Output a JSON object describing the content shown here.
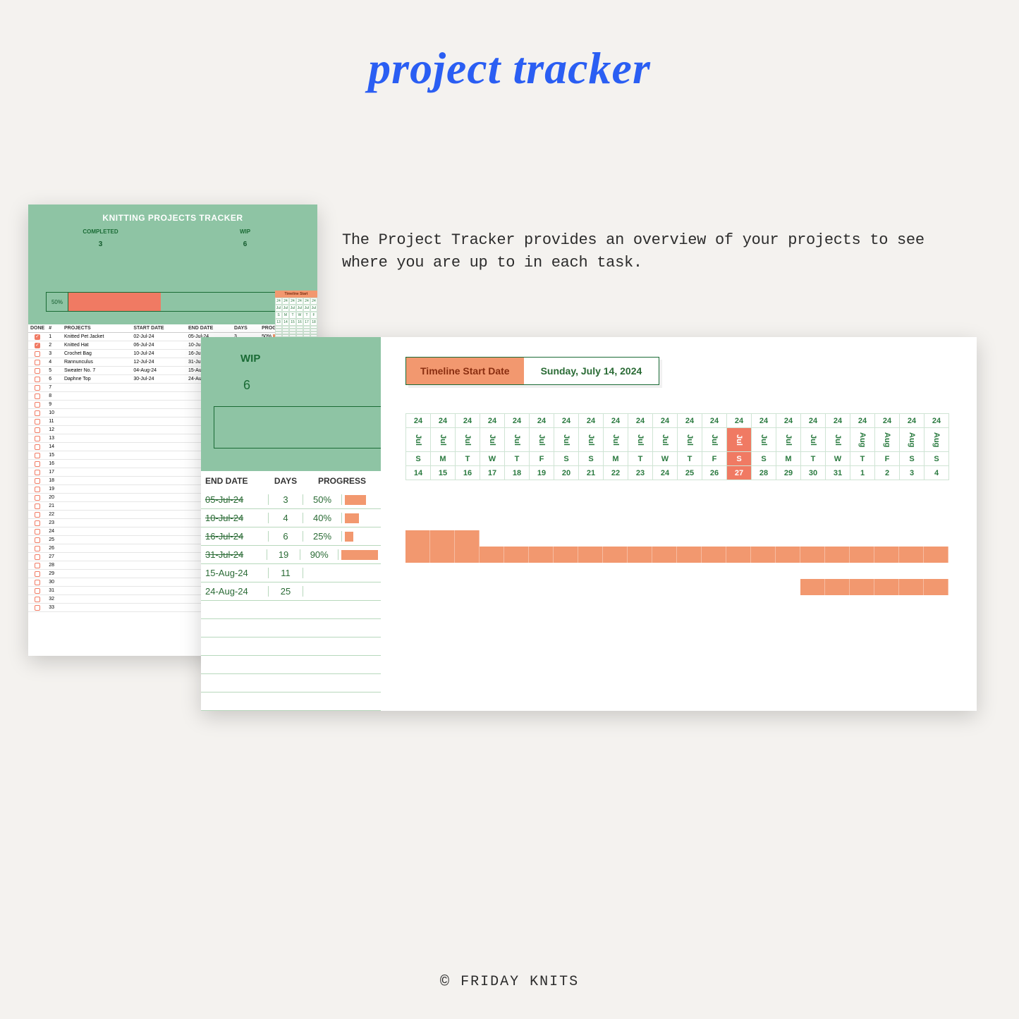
{
  "page": {
    "title": "project tracker",
    "description": "The Project Tracker  provides an overview of your projects to see where you are up to in each task.",
    "footer_brand": "FRIDAY KNITS"
  },
  "tracker": {
    "title": "KNITTING PROJECTS TRACKER",
    "stats": {
      "completed_label": "COMPLETED",
      "completed": "3",
      "wip_label": "WIP",
      "wip": "6"
    },
    "overall_progress_label": "50%",
    "overall_progress_pct": 40,
    "columns": {
      "done": "DONE",
      "num": "#",
      "projects": "PROJECTS",
      "start": "START DATE",
      "end": "END DATE",
      "days": "DAYS",
      "progress": "PROGRESS"
    },
    "rows": [
      {
        "done": true,
        "n": "1",
        "name": "Knitted Pet Jacket",
        "start": "02-Jul-24",
        "end": "05-Jul-24",
        "days": "3",
        "pct": "50%"
      },
      {
        "done": true,
        "n": "2",
        "name": "Knitted Hat",
        "start": "06-Jul-24",
        "end": "10-Jul-24",
        "days": "4",
        "pct": "40%"
      },
      {
        "done": false,
        "n": "3",
        "name": "Crochet Bag",
        "start": "10-Jul-24",
        "end": "16-Jul-24",
        "days": "6",
        "pct": "25%"
      },
      {
        "done": false,
        "n": "4",
        "name": "Rannunculus",
        "start": "12-Jul-24",
        "end": "31-Jul-24",
        "days": "19",
        "pct": "90%"
      },
      {
        "done": false,
        "n": "5",
        "name": "Sweater No. 7",
        "start": "04-Aug-24",
        "end": "15-Aug-24",
        "days": "11",
        "pct": ""
      },
      {
        "done": false,
        "n": "6",
        "name": "Daphne Top",
        "start": "30-Jul-24",
        "end": "24-Aug-24",
        "days": "25",
        "pct": ""
      }
    ],
    "empty_row_start": 7,
    "empty_row_end": 33
  },
  "detail": {
    "wip_label": "WIP",
    "wip": "6",
    "col_end": "END DATE",
    "col_days": "DAYS",
    "col_progress": "PROGRESS",
    "rows": [
      {
        "end": "05-Jul-24",
        "days": "3",
        "pct": "50%",
        "bar": 30,
        "strike": true
      },
      {
        "end": "10-Jul-24",
        "days": "4",
        "pct": "40%",
        "bar": 20,
        "strike": true
      },
      {
        "end": "16-Jul-24",
        "days": "6",
        "pct": "25%",
        "bar": 12,
        "strike": true
      },
      {
        "end": "31-Jul-24",
        "days": "19",
        "pct": "90%",
        "bar": 52,
        "strike": true
      },
      {
        "end": "15-Aug-24",
        "days": "11",
        "pct": "",
        "bar": 0,
        "strike": false
      },
      {
        "end": "24-Aug-24",
        "days": "25",
        "pct": "",
        "bar": 0,
        "strike": false
      }
    ],
    "timeline_label": "Timeline Start Date",
    "timeline_value": "Sunday, July 14, 2024",
    "cal": {
      "years": [
        "24",
        "24",
        "24",
        "24",
        "24",
        "24",
        "24",
        "24",
        "24",
        "24",
        "24",
        "24",
        "24",
        "24",
        "24",
        "24",
        "24",
        "24",
        "24",
        "24",
        "24",
        "24"
      ],
      "months": [
        "Jul",
        "Jul",
        "Jul",
        "Jul",
        "Jul",
        "Jul",
        "Jul",
        "Jul",
        "Jul",
        "Jul",
        "Jul",
        "Jul",
        "Jul",
        "Jul",
        "Jul",
        "Jul",
        "Jul",
        "Jul",
        "Aug",
        "Aug",
        "Aug",
        "Aug"
      ],
      "dows": [
        "S",
        "M",
        "T",
        "W",
        "T",
        "F",
        "S",
        "S",
        "M",
        "T",
        "W",
        "T",
        "F",
        "S",
        "S",
        "M",
        "T",
        "W",
        "T",
        "F",
        "S",
        "S"
      ],
      "days": [
        "14",
        "15",
        "16",
        "17",
        "18",
        "19",
        "20",
        "21",
        "22",
        "23",
        "24",
        "25",
        "26",
        "27",
        "28",
        "29",
        "30",
        "31",
        "1",
        "2",
        "3",
        "4"
      ],
      "highlight_index": 13
    },
    "gantt": [
      {
        "start": 0,
        "len": 0
      },
      {
        "start": 0,
        "len": 0
      },
      {
        "start": 0,
        "len": 3
      },
      {
        "start": 0,
        "len": 22
      },
      {
        "start": 0,
        "len": 0
      },
      {
        "start": 16,
        "len": 6
      }
    ]
  }
}
